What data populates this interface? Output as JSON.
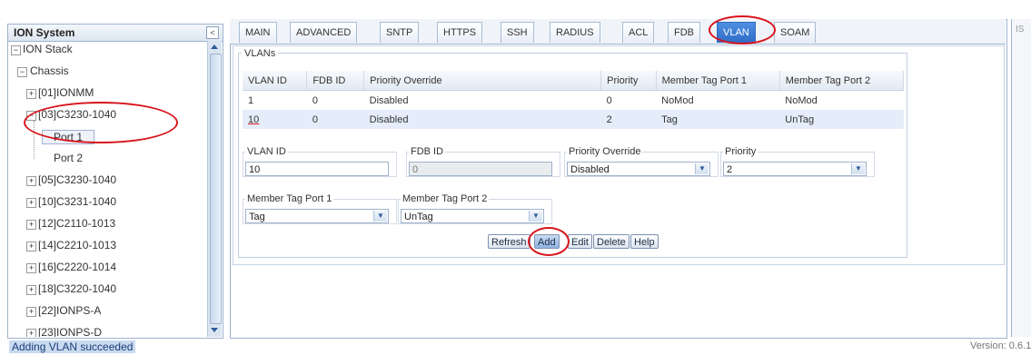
{
  "tree": {
    "title": "ION System",
    "collapse_icon": "<",
    "nodes": [
      {
        "label": "ION Stack",
        "expander": "−"
      },
      {
        "label": "Chassis",
        "expander": "−"
      },
      {
        "label": "[01]IONMM",
        "expander": "+"
      },
      {
        "label": "[03]C3230-1040",
        "expander": "−"
      },
      {
        "label": "Port 1",
        "expander": ""
      },
      {
        "label": "Port 2",
        "expander": ""
      },
      {
        "label": "[05]C3230-1040",
        "expander": "+"
      },
      {
        "label": "[10]C3231-1040",
        "expander": "+"
      },
      {
        "label": "[12]C2110-1013",
        "expander": "+"
      },
      {
        "label": "[14]C2210-1013",
        "expander": "+"
      },
      {
        "label": "[16]C2220-1014",
        "expander": "+"
      },
      {
        "label": "[18]C3220-1040",
        "expander": "+"
      },
      {
        "label": "[22]IONPS-A",
        "expander": "+"
      },
      {
        "label": "[23]IONPS-D",
        "expander": "+"
      }
    ]
  },
  "tabs": [
    "MAIN",
    "ADVANCED",
    "SNTP",
    "HTTPS",
    "SSH",
    "RADIUS",
    "ACL",
    "FDB",
    "VLAN",
    "SOAM"
  ],
  "active_tab": "VLAN",
  "vlans": {
    "legend": "VLANs",
    "columns": [
      "VLAN ID",
      "FDB ID",
      "Priority Override",
      "Priority",
      "Member Tag Port 1",
      "Member Tag Port 2"
    ],
    "rows": [
      [
        "1",
        "0",
        "Disabled",
        "0",
        "NoMod",
        "NoMod"
      ],
      [
        "10",
        "0",
        "Disabled",
        "2",
        "Tag",
        "UnTag"
      ]
    ]
  },
  "form": {
    "vlan_id_label": "VLAN ID",
    "vlan_id_value": "10",
    "fdb_id_label": "FDB ID",
    "fdb_id_value": "0",
    "priority_override_label": "Priority Override",
    "priority_override_value": "Disabled",
    "priority_label": "Priority",
    "priority_value": "2",
    "member_tag_port1_label": "Member Tag Port 1",
    "member_tag_port1_value": "Tag",
    "member_tag_port2_label": "Member Tag Port 2",
    "member_tag_port2_value": "UnTag"
  },
  "buttons": {
    "refresh": "Refresh",
    "add": "Add",
    "edit": "Edit",
    "delete": "Delete",
    "help": "Help"
  },
  "right_panel_label": "IS",
  "status": {
    "message": "Adding VLAN succeeded",
    "version": "Version: 0.6.1"
  },
  "colors": {
    "accent": "#2e6cc7",
    "annotation_red": "#d8141b",
    "status_highlight": "#c9daf0"
  }
}
